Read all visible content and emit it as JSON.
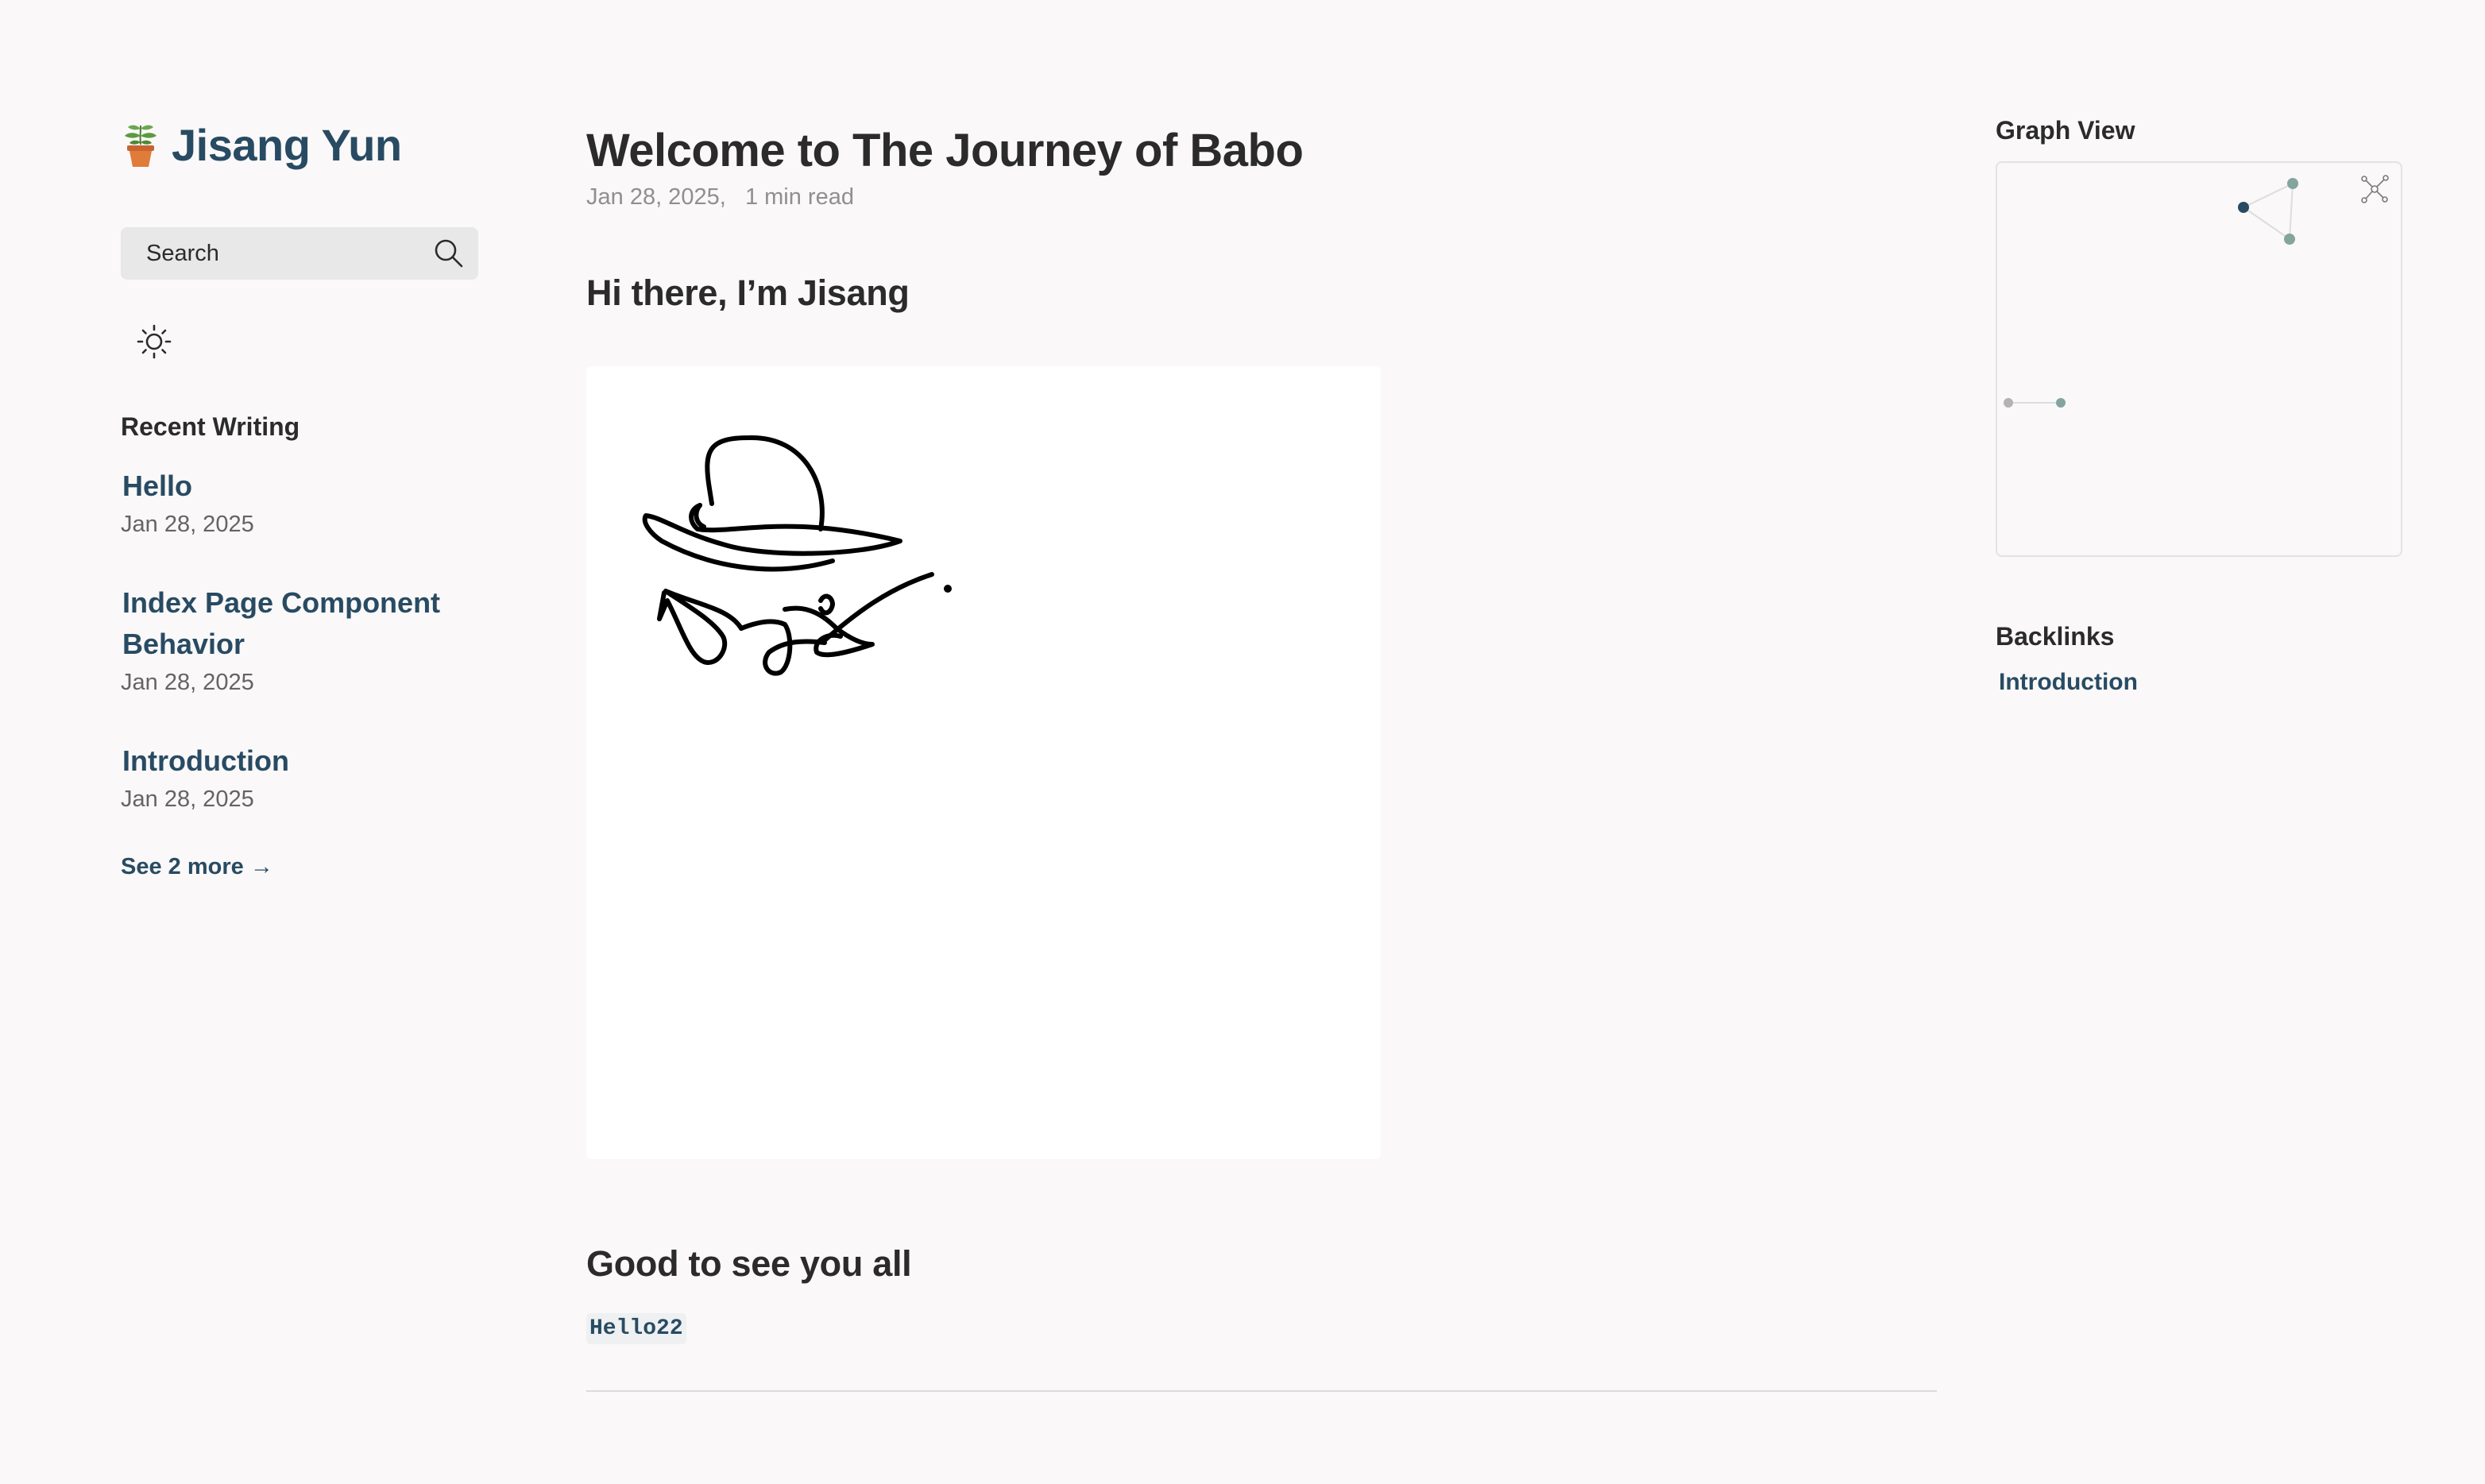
{
  "site": {
    "title": "Jisang Yun",
    "logo_icon": "potted-plant-icon"
  },
  "search": {
    "placeholder": "Search",
    "icon": "search-icon"
  },
  "theme_toggle": {
    "icon": "sun-icon"
  },
  "recent": {
    "title": "Recent Writing",
    "items": [
      {
        "title": "Hello",
        "date": "Jan 28, 2025"
      },
      {
        "title": "Index Page Component Behavior",
        "date": "Jan 28, 2025"
      },
      {
        "title": "Introduction",
        "date": "Jan 28, 2025"
      }
    ],
    "see_more": "See 2 more →"
  },
  "article": {
    "title": "Welcome to The Journey of Babo",
    "date": "Jan 28, 2025,",
    "reading_time": "1 min read",
    "heading_1": "Hi there, I’m Jisang",
    "heading_2": "Good to see you all",
    "tag": "Hello22"
  },
  "graph": {
    "title": "Graph View",
    "global_icon": "global-graph-icon"
  },
  "backlinks": {
    "title": "Backlinks",
    "items": [
      "Introduction"
    ]
  },
  "colors": {
    "background": "#faf8f8",
    "accent": "#284b63",
    "graph_node": "#84a59d",
    "graph_node_inactive": "#b3b3b3"
  }
}
